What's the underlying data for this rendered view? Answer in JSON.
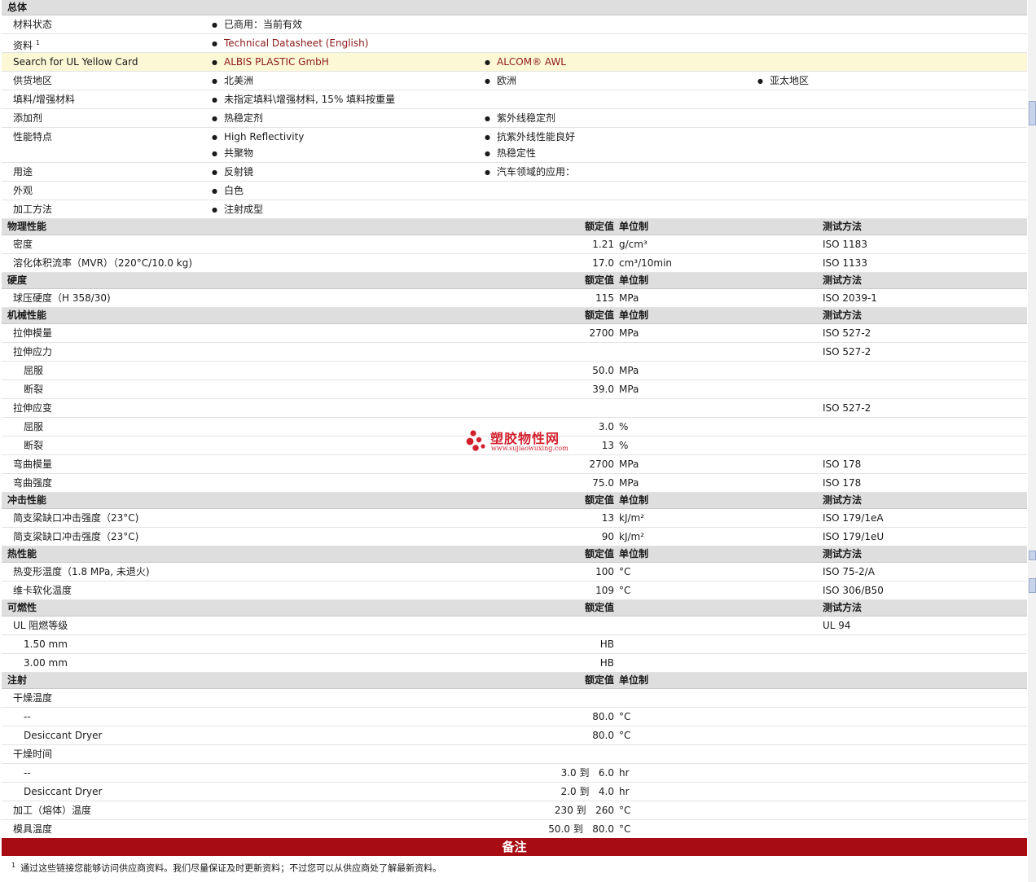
{
  "general": {
    "header": "总体",
    "material_status": {
      "label": "材料状态",
      "values": [
        "已商用：当前有效"
      ]
    },
    "documents": {
      "label": "资料",
      "footnote": "1",
      "values": [
        "Technical Datasheet (English)"
      ]
    },
    "ul_card": {
      "label": "Search for UL Yellow Card",
      "values": [
        "ALBIS PLASTIC GmbH",
        "ALCOM® AWL"
      ]
    },
    "regions": {
      "label": "供货地区",
      "values": [
        "北美洲",
        "欧洲",
        "亚太地区"
      ]
    },
    "filler": {
      "label": "填料/增强材料",
      "values": [
        "未指定填料\\增强材料, 15% 填料按重量"
      ]
    },
    "additives": {
      "label": "添加剂",
      "values": [
        "热稳定剂",
        "紫外线稳定剂"
      ]
    },
    "features": {
      "label": "性能特点",
      "values": [
        "High Reflectivity",
        "抗紫外线性能良好",
        "共聚物",
        "热稳定性"
      ]
    },
    "uses": {
      "label": "用途",
      "values": [
        "反射镜",
        "汽车领域的应用："
      ]
    },
    "appearance": {
      "label": "外观",
      "values": [
        "白色"
      ]
    },
    "processing": {
      "label": "加工方法",
      "values": [
        "注射成型"
      ]
    }
  },
  "col_headers": {
    "nominal": "额定值",
    "unit": "单位制",
    "method": "测试方法"
  },
  "physical": {
    "header": "物理性能",
    "rows": [
      {
        "label": "密度",
        "value": "1.21",
        "unit": "g/cm³",
        "method": "ISO 1183"
      },
      {
        "label": "溶化体积流率（MVR）（220°C/10.0 kg)",
        "value": "17.0",
        "unit": "cm³/10min",
        "method": "ISO 1133"
      }
    ]
  },
  "hardness": {
    "header": "硬度",
    "rows": [
      {
        "label": "球压硬度（H 358/30)",
        "value": "115",
        "unit": "MPa",
        "method": "ISO 2039-1"
      }
    ]
  },
  "mechanical": {
    "header": "机械性能",
    "modulus": {
      "label": "拉伸模量",
      "value": "2700",
      "unit": "MPa",
      "method": "ISO 527-2"
    },
    "stress": {
      "label": "拉伸应力",
      "method": "ISO 527-2"
    },
    "stress_yield": {
      "label": "屈服",
      "value": "50.0",
      "unit": "MPa"
    },
    "stress_break": {
      "label": "断裂",
      "value": "39.0",
      "unit": "MPa"
    },
    "strain": {
      "label": "拉伸应变",
      "method": "ISO 527-2"
    },
    "strain_yield": {
      "label": "屈服",
      "value": "3.0",
      "unit": "%"
    },
    "strain_break": {
      "label": "断裂",
      "value": "13",
      "unit": "%"
    },
    "flex_modulus": {
      "label": "弯曲模量",
      "value": "2700",
      "unit": "MPa",
      "method": "ISO 178"
    },
    "flex_strength": {
      "label": "弯曲强度",
      "value": "75.0",
      "unit": "MPa",
      "method": "ISO 178"
    }
  },
  "impact": {
    "header": "冲击性能",
    "rows": [
      {
        "label": "简支梁缺口冲击强度（23°C)",
        "value": "13",
        "unit": "kJ/m²",
        "method": "ISO 179/1eA"
      },
      {
        "label": "简支梁缺口冲击强度（23°C)",
        "value": "90",
        "unit": "kJ/m²",
        "method": "ISO 179/1eU"
      }
    ]
  },
  "thermal": {
    "header": "热性能",
    "rows": [
      {
        "label": "热变形温度（1.8 MPa, 未退火)",
        "value": "100",
        "unit": "°C",
        "method": "ISO 75-2/A"
      },
      {
        "label": "维卡软化温度",
        "value": "109",
        "unit": "°C",
        "method": "ISO 306/B50"
      }
    ]
  },
  "flammability": {
    "header": "可燃性",
    "ul": {
      "label": "UL 阻燃等级",
      "method": "UL 94"
    },
    "rows": [
      {
        "label": "1.50 mm",
        "value": "HB"
      },
      {
        "label": "3.00 mm",
        "value": "HB"
      }
    ]
  },
  "injection": {
    "header": "注射",
    "dry_temp": {
      "label": "干燥温度"
    },
    "dry_temp_rows": [
      {
        "label": "--",
        "value": "80.0",
        "unit": "°C"
      },
      {
        "label": "Desiccant Dryer",
        "value": "80.0",
        "unit": "°C"
      }
    ],
    "dry_time": {
      "label": "干燥时间"
    },
    "dry_time_rows": [
      {
        "label": "--",
        "value": "3.0 到   6.0",
        "unit": "hr"
      },
      {
        "label": "Desiccant Dryer",
        "value": "2.0 到   4.0",
        "unit": "hr"
      }
    ],
    "melt": {
      "label": "加工（熔体）温度",
      "value": "230 到   260",
      "unit": "°C"
    },
    "mold": {
      "label": "模具温度",
      "value": "50.0 到   80.0",
      "unit": "°C"
    }
  },
  "notes": {
    "header": "备注",
    "footnote_num": "1",
    "text": "通过这些链接您能够访问供应商资料。我们尽量保证及时更新资料；不过您可以从供应商处了解最新资料。"
  },
  "watermark": {
    "title": "塑胶物性网",
    "url": "www.sujiaowuxing.com"
  },
  "colors": {
    "section_bg": "#dedede",
    "highlight_bg": "#fcf8d6",
    "link": "#8b1a1a",
    "notes_bar": "#a80c13",
    "watermark": "#d2202e"
  }
}
